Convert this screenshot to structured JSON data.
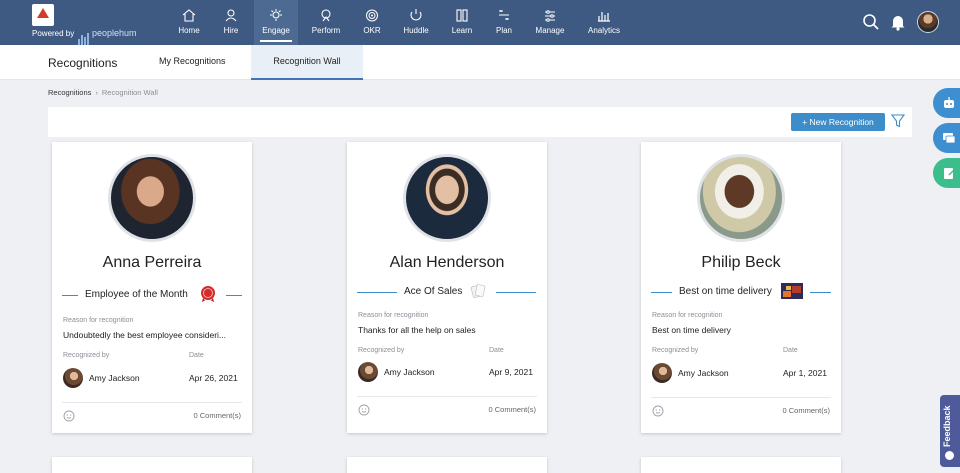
{
  "brand": {
    "powered_by": "Powered by",
    "product": "peoplehum"
  },
  "nav": [
    {
      "label": "Home",
      "icon": "home-icon"
    },
    {
      "label": "Hire",
      "icon": "hire-icon"
    },
    {
      "label": "Engage",
      "icon": "engage-icon",
      "active": true
    },
    {
      "label": "Perform",
      "icon": "perform-icon"
    },
    {
      "label": "OKR",
      "icon": "okr-icon"
    },
    {
      "label": "Huddle",
      "icon": "huddle-icon"
    },
    {
      "label": "Learn",
      "icon": "learn-icon"
    },
    {
      "label": "Plan",
      "icon": "plan-icon"
    },
    {
      "label": "Manage",
      "icon": "manage-icon"
    },
    {
      "label": "Analytics",
      "icon": "analytics-icon"
    }
  ],
  "subnav": {
    "title": "Recognitions",
    "tabs": [
      {
        "label": "My Recognitions"
      },
      {
        "label": "Recognition Wall",
        "active": true
      }
    ]
  },
  "breadcrumb": {
    "root": "Recognitions",
    "current": "Recognition Wall"
  },
  "toolbar": {
    "new_label": "+ New Recognition"
  },
  "labels": {
    "reason": "Reason for recognition",
    "recognized_by": "Recognized by",
    "date": "Date"
  },
  "cards": [
    {
      "name": "Anna Perreira",
      "award": "Employee of the Month",
      "reason": "Undoubtedly the best employee consideri...",
      "recognized_by": "Amy Jackson",
      "date": "Apr 26, 2021",
      "comments": "0 Comment(s)"
    },
    {
      "name": "Alan Henderson",
      "award": "Ace Of Sales",
      "reason": "Thanks for all the help on sales",
      "recognized_by": "Amy Jackson",
      "date": "Apr 9, 2021",
      "comments": "0 Comment(s)"
    },
    {
      "name": "Philip Beck",
      "award": "Best on time delivery",
      "reason": "Best on time delivery",
      "recognized_by": "Amy Jackson",
      "date": "Apr 1, 2021",
      "comments": "0 Comment(s)"
    }
  ],
  "feedback": {
    "label": "Feedback"
  },
  "colors": {
    "nav_bg": "#3f5a82",
    "accent": "#3c8dc9",
    "side_blue": "#3d8fd0",
    "side_green": "#3cbd8c",
    "feedback": "#4e5a9a"
  }
}
